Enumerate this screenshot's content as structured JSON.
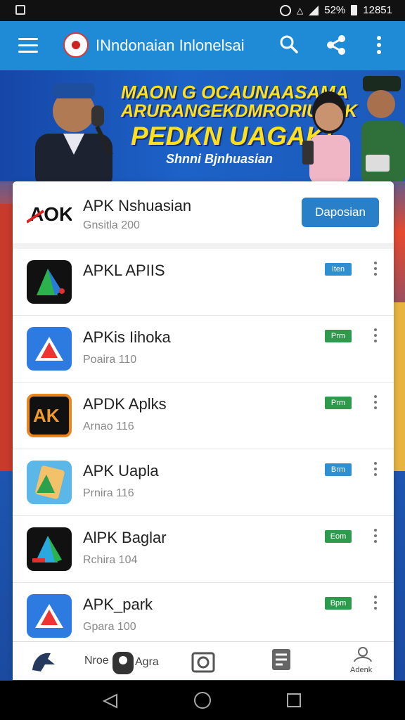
{
  "status_bar": {
    "battery": "52%",
    "time": "12851"
  },
  "app_bar": {
    "title": "INndonaian Inlonelsai"
  },
  "banner": {
    "line1": "MAON G OCAUNAASAMA",
    "line2": "ARURANGEKDMRORIUNNK",
    "line3": "PEDKN UAGAK!",
    "subtitle": "Shnni Bjnhuasian"
  },
  "header": {
    "name": "APK Nshuasian",
    "meta": "Gnsitla 200",
    "button_label": "Daposian"
  },
  "apps": [
    {
      "name": "APKL APIIS",
      "meta": "",
      "badge": "Iten",
      "badge_color": "#2e8fd1"
    },
    {
      "name": "APKis Iihoka",
      "meta": "Poaira 110",
      "badge": "Prm",
      "badge_color": "#2e9a4c"
    },
    {
      "name": "APDK Aplks",
      "meta": "Arnao 116",
      "badge": "Prm",
      "badge_color": "#2e9a4c"
    },
    {
      "name": "APK Uapla",
      "meta": "Prnira 116",
      "badge": "Brm",
      "badge_color": "#2e8fd1"
    },
    {
      "name": "AlPK Baglar",
      "meta": "Rchira 104",
      "badge": "Eom",
      "badge_color": "#2e9a4c"
    },
    {
      "name": "APK_park",
      "meta": "Gpara 100",
      "badge": "Bpm",
      "badge_color": "#2e9a4c"
    }
  ],
  "bottom_nav": {
    "items": [
      {
        "label": "",
        "icon": "home-icon"
      },
      {
        "label": "Nroe",
        "icon": "person-icon"
      },
      {
        "label": "Agra",
        "icon": ""
      },
      {
        "label": "",
        "icon": "gallery-icon"
      },
      {
        "label": "",
        "icon": "news-icon"
      },
      {
        "label": "Adenk",
        "icon": "profile-icon"
      }
    ]
  },
  "colors": {
    "app_bar": "#1f8bd6",
    "primary_button": "#2a80c8",
    "banner_text": "#ffe01a"
  }
}
